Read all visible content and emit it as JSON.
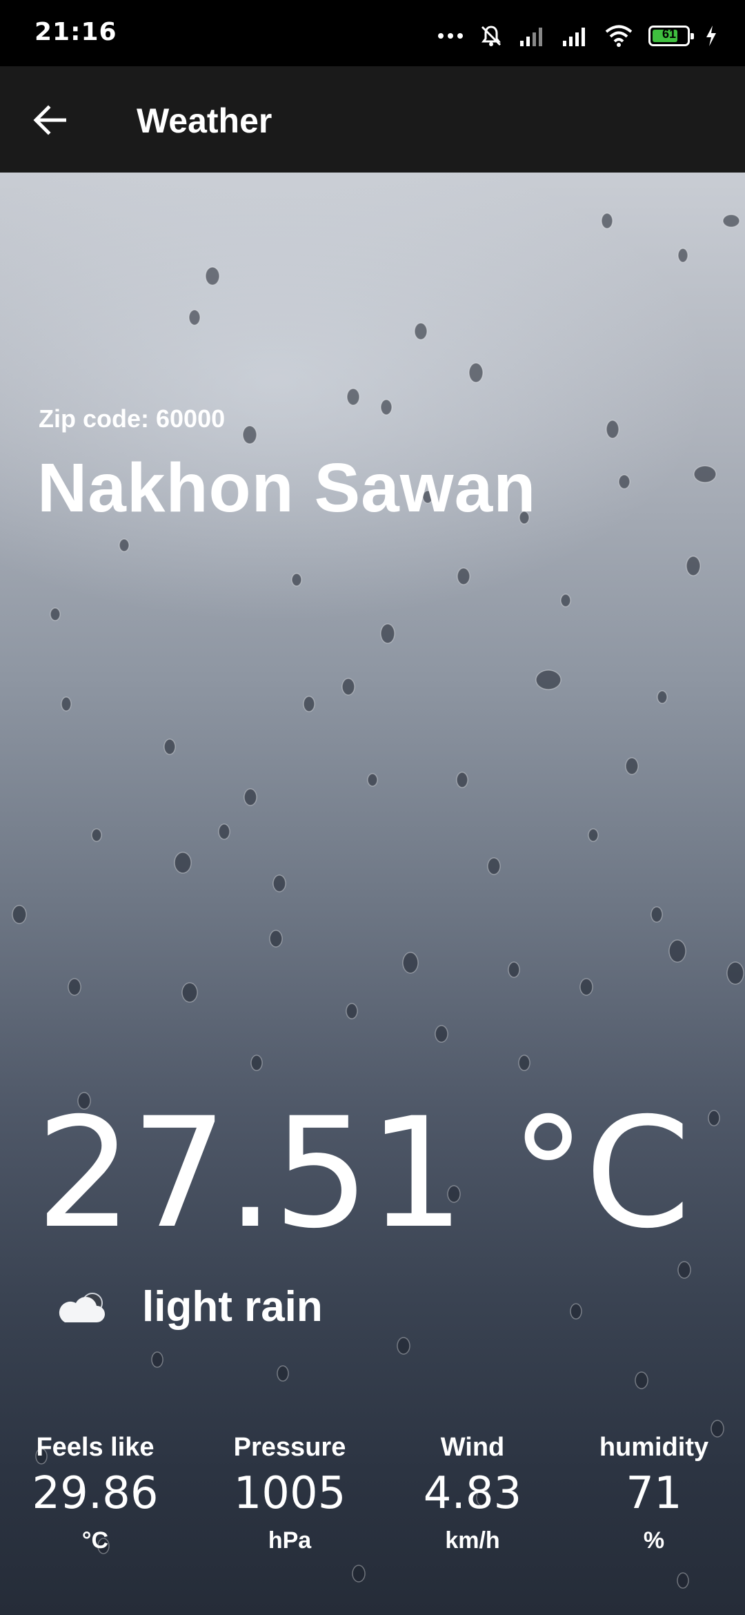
{
  "status_bar": {
    "time": "21:16",
    "battery_level": "61",
    "icons": [
      "more-icon",
      "mute-icon",
      "signal-icon",
      "signal-icon",
      "wifi-icon",
      "battery-icon",
      "charging-icon"
    ]
  },
  "app_bar": {
    "back_icon": "arrow-left-icon",
    "title": "Weather"
  },
  "location": {
    "zip_label": "Zip code: 60000",
    "city": "Nakhon Sawan"
  },
  "current": {
    "temperature": "27.51 °C",
    "condition_icon": "cloud-icon",
    "condition": "light rain"
  },
  "metrics": [
    {
      "label": "Feels like",
      "value": "29.86",
      "unit": "°C"
    },
    {
      "label": "Pressure",
      "value": "1005",
      "unit": "hPa"
    },
    {
      "label": "Wind",
      "value": "4.83",
      "unit": "km/h"
    },
    {
      "label": "humidity",
      "value": "71",
      "unit": "%"
    }
  ],
  "colors": {
    "status_bar_bg": "#000000",
    "app_bar_bg": "#1a1a1a",
    "battery_fill": "#3fbf3f",
    "text": "#ffffff"
  }
}
